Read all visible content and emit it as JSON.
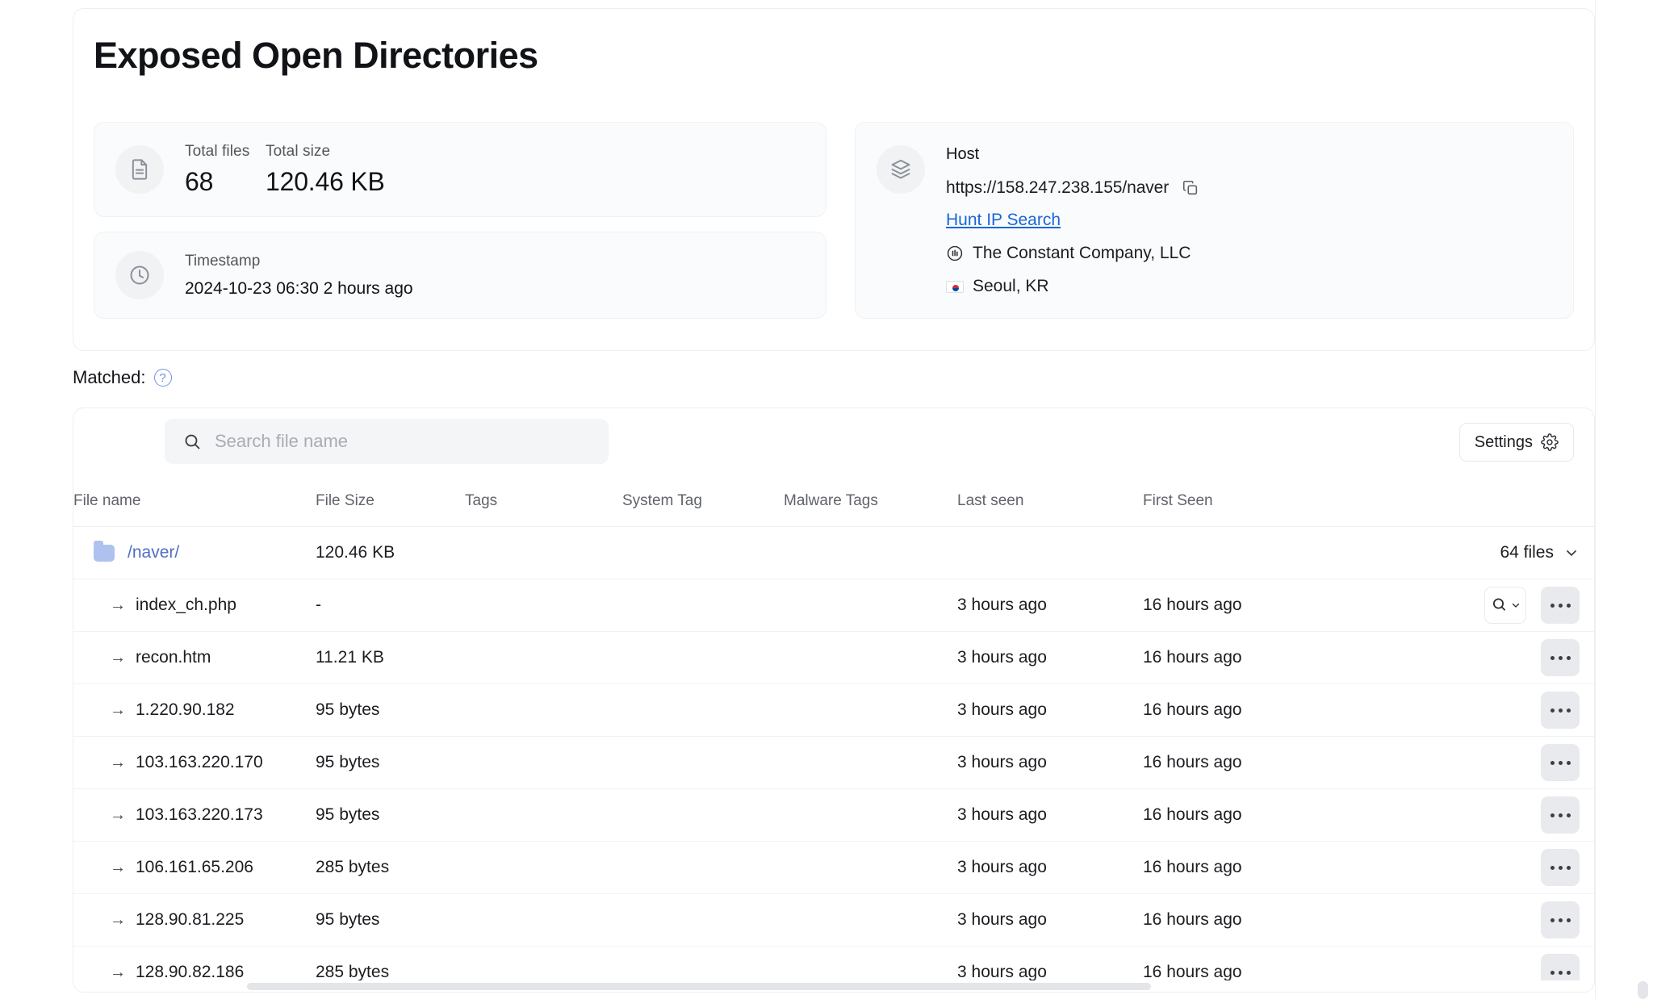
{
  "header": {
    "title": "Exposed Open Directories"
  },
  "summary": {
    "files_tile": {
      "icon": "document-icon",
      "total_files_label": "Total files",
      "total_files_value": "68",
      "total_size_label": "Total size",
      "total_size_value": "120.46 KB"
    },
    "timestamp_tile": {
      "icon": "clock-icon",
      "label": "Timestamp",
      "value": "2024-10-23 06:30 2 hours ago"
    },
    "host_tile": {
      "icon": "layers-icon",
      "label": "Host",
      "url": "https://158.247.238.155/naver",
      "copy_icon": "copy-icon",
      "link_label": "Hunt IP Search",
      "org_icon": "org-building-icon",
      "org": "The Constant Company, LLC",
      "location_flag": "kr-flag-icon",
      "location": "Seoul, KR"
    }
  },
  "matched": {
    "label": "Matched:",
    "help_icon": "help-circle-icon"
  },
  "toolbar": {
    "search_icon": "search-icon",
    "search_value": "",
    "search_placeholder": "Search file name",
    "settings_label": "Settings",
    "settings_icon": "gear-icon"
  },
  "table": {
    "columns": [
      "File name",
      "File Size",
      "Tags",
      "System Tag",
      "Malware Tags",
      "Last seen",
      "First Seen"
    ],
    "folder_row": {
      "icon": "folder-icon",
      "name": "/naver/",
      "size": "120.46 KB",
      "files_count": "64 files",
      "chevron_icon": "chevron-down-icon"
    },
    "rows": [
      {
        "arrow": "→",
        "name": "index_ch.php",
        "size": "-",
        "tags": "",
        "system_tag": "",
        "malware_tags": "",
        "last_seen": "3 hours ago",
        "first_seen": "16 hours ago",
        "has_search_button": true
      },
      {
        "arrow": "→",
        "name": "recon.htm",
        "size": "11.21 KB",
        "tags": "",
        "system_tag": "",
        "malware_tags": "",
        "last_seen": "3 hours ago",
        "first_seen": "16 hours ago",
        "has_search_button": false
      },
      {
        "arrow": "→",
        "name": "1.220.90.182",
        "size": "95 bytes",
        "tags": "",
        "system_tag": "",
        "malware_tags": "",
        "last_seen": "3 hours ago",
        "first_seen": "16 hours ago",
        "has_search_button": false
      },
      {
        "arrow": "→",
        "name": "103.163.220.170",
        "size": "95 bytes",
        "tags": "",
        "system_tag": "",
        "malware_tags": "",
        "last_seen": "3 hours ago",
        "first_seen": "16 hours ago",
        "has_search_button": false
      },
      {
        "arrow": "→",
        "name": "103.163.220.173",
        "size": "95 bytes",
        "tags": "",
        "system_tag": "",
        "malware_tags": "",
        "last_seen": "3 hours ago",
        "first_seen": "16 hours ago",
        "has_search_button": false
      },
      {
        "arrow": "→",
        "name": "106.161.65.206",
        "size": "285 bytes",
        "tags": "",
        "system_tag": "",
        "malware_tags": "",
        "last_seen": "3 hours ago",
        "first_seen": "16 hours ago",
        "has_search_button": false
      },
      {
        "arrow": "→",
        "name": "128.90.81.225",
        "size": "95 bytes",
        "tags": "",
        "system_tag": "",
        "malware_tags": "",
        "last_seen": "3 hours ago",
        "first_seen": "16 hours ago",
        "has_search_button": false
      },
      {
        "arrow": "→",
        "name": "128.90.82.186",
        "size": "285 bytes",
        "tags": "",
        "system_tag": "",
        "malware_tags": "",
        "last_seen": "3 hours ago",
        "first_seen": "16 hours ago",
        "has_search_button": false
      }
    ]
  },
  "colors": {
    "link": "#1a66d6",
    "folder": "#aec1ef",
    "folder_text": "#4f6ec4",
    "help": "#6d93e0"
  }
}
